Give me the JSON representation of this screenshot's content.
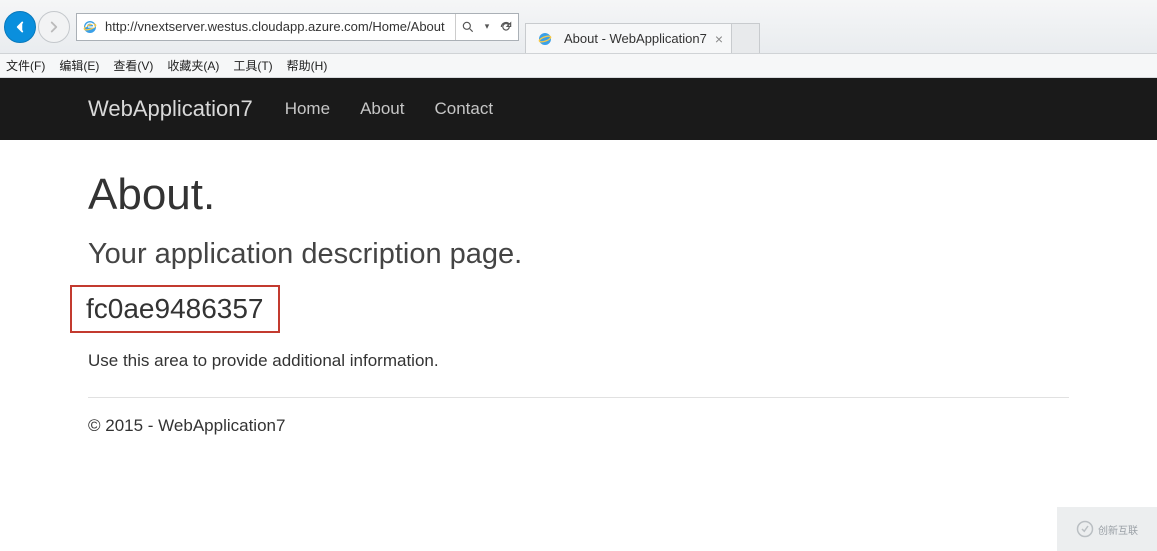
{
  "browser": {
    "url": "http://vnextserver.westus.cloudapp.azure.com/Home/About",
    "tab_title": "About - WebApplication7"
  },
  "menubar": {
    "file": "文件(F)",
    "edit": "编辑(E)",
    "view": "查看(V)",
    "favorites": "收藏夹(A)",
    "tools": "工具(T)",
    "help": "帮助(H)"
  },
  "navbar": {
    "brand": "WebApplication7",
    "links": {
      "home": "Home",
      "about": "About",
      "contact": "Contact"
    }
  },
  "page": {
    "title": "About.",
    "subtitle": "Your application description page.",
    "highlight": "fc0ae9486357",
    "description": "Use this area to provide additional information.",
    "footer": "© 2015 - WebApplication7"
  },
  "watermark": {
    "text": "创新互联"
  }
}
